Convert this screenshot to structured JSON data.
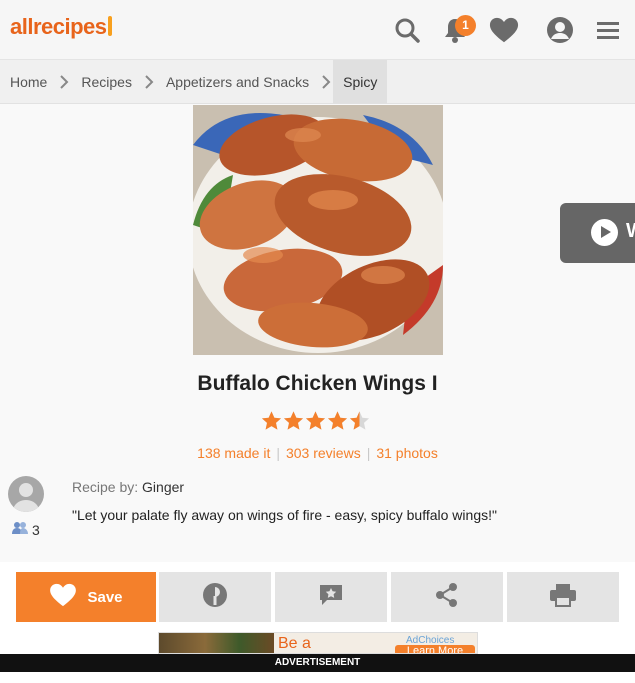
{
  "header": {
    "logo_text": "allrecipes",
    "notification_count": "1",
    "icons": [
      "search-icon",
      "bell-icon",
      "heart-icon",
      "profile-icon",
      "menu-icon"
    ],
    "brand_color": "#f4802b"
  },
  "breadcrumb": [
    "Home",
    "Recipes",
    "Appetizers and Snacks",
    "Spicy"
  ],
  "recipe": {
    "title": "Buffalo Chicken Wings I",
    "rating": 4.5,
    "rating_max": 5,
    "made_it": "138 made it",
    "reviews": "303 reviews",
    "photos": "31 photos",
    "recipe_by_label": "Recipe by:",
    "author": "Ginger",
    "followers": "3",
    "description": "\"Let your palate fly away on wings of fire - easy, spicy buffalo wings!\"",
    "video_label": "W"
  },
  "actions": {
    "save_label": "Save",
    "items": [
      "save-button",
      "made-it-button",
      "review-button",
      "share-button",
      "print-button"
    ]
  },
  "ad": {
    "headline": "Be a",
    "choices": "AdChoices",
    "learn": "Learn More",
    "label": "ADVERTISEMENT"
  }
}
